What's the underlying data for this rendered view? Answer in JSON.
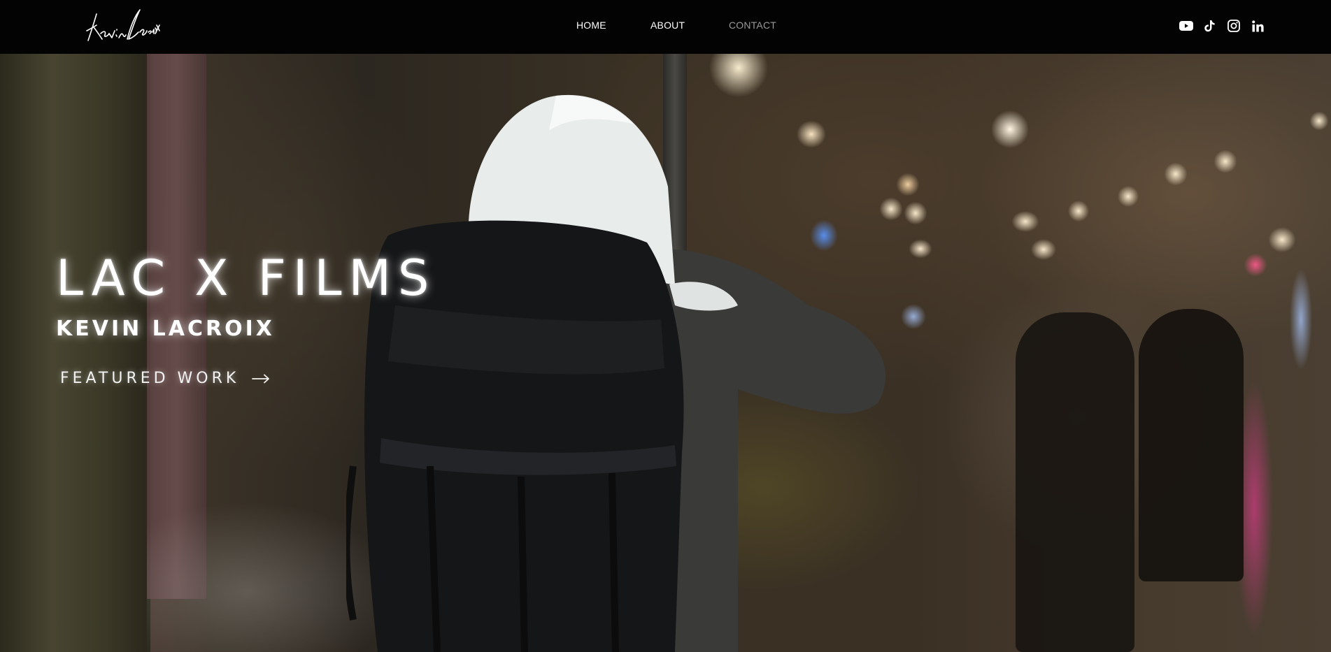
{
  "header": {
    "logo_text": "Kevin Lacroix",
    "nav": [
      {
        "label": "HOME"
      },
      {
        "label": "ABOUT"
      },
      {
        "label": "CONTACT",
        "current": true
      }
    ],
    "social": [
      {
        "name": "youtube-icon"
      },
      {
        "name": "tiktok-icon"
      },
      {
        "name": "instagram-icon"
      },
      {
        "name": "linkedin-icon"
      }
    ]
  },
  "hero": {
    "title": "LAC X FILMS",
    "subtitle": "KEVIN LACROIX",
    "cta_label": "FEATURED WORK",
    "cta_icon": "arrow-right-icon"
  },
  "colors": {
    "header_bg": "#030303",
    "nav_text": "#ffffff",
    "nav_current": "#9a9a9a",
    "hero_text": "#ffffff"
  }
}
